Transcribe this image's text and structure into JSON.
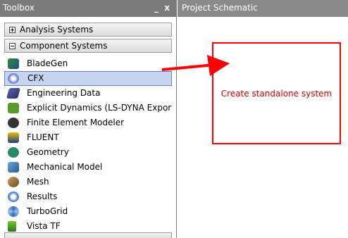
{
  "toolbox": {
    "title": "Toolbox",
    "minimize_glyph": "_",
    "close_glyph": "x",
    "groups": [
      {
        "label": "Analysis Systems",
        "state": "collapsed"
      },
      {
        "label": "Component Systems",
        "state": "expanded"
      }
    ],
    "items": [
      {
        "label": "BladeGen",
        "icon": "bladegen-icon"
      },
      {
        "label": "CFX",
        "icon": "cfx-icon",
        "selected": true
      },
      {
        "label": "Engineering Data",
        "icon": "engineering-data-icon"
      },
      {
        "label": "Explicit Dynamics (LS-DYNA Expor",
        "icon": "explicit-dynamics-icon"
      },
      {
        "label": "Finite Element Modeler",
        "icon": "finite-element-modeler-icon"
      },
      {
        "label": "FLUENT",
        "icon": "fluent-icon"
      },
      {
        "label": "Geometry",
        "icon": "geometry-icon"
      },
      {
        "label": "Mechanical Model",
        "icon": "mechanical-model-icon"
      },
      {
        "label": "Mesh",
        "icon": "mesh-icon"
      },
      {
        "label": "Results",
        "icon": "results-icon"
      },
      {
        "label": "TurboGrid",
        "icon": "turbogrid-icon"
      },
      {
        "label": "Vista TF",
        "icon": "vista-tf-icon"
      }
    ]
  },
  "schematic": {
    "title": "Project Schematic",
    "callout_text": "Create standalone system"
  },
  "colors": {
    "titlebar": "#7b7b7b",
    "selection": "#c6d4ef",
    "callout_border": "#ff0000",
    "callout_text": "#d80000",
    "arrow": "#ff0000"
  }
}
